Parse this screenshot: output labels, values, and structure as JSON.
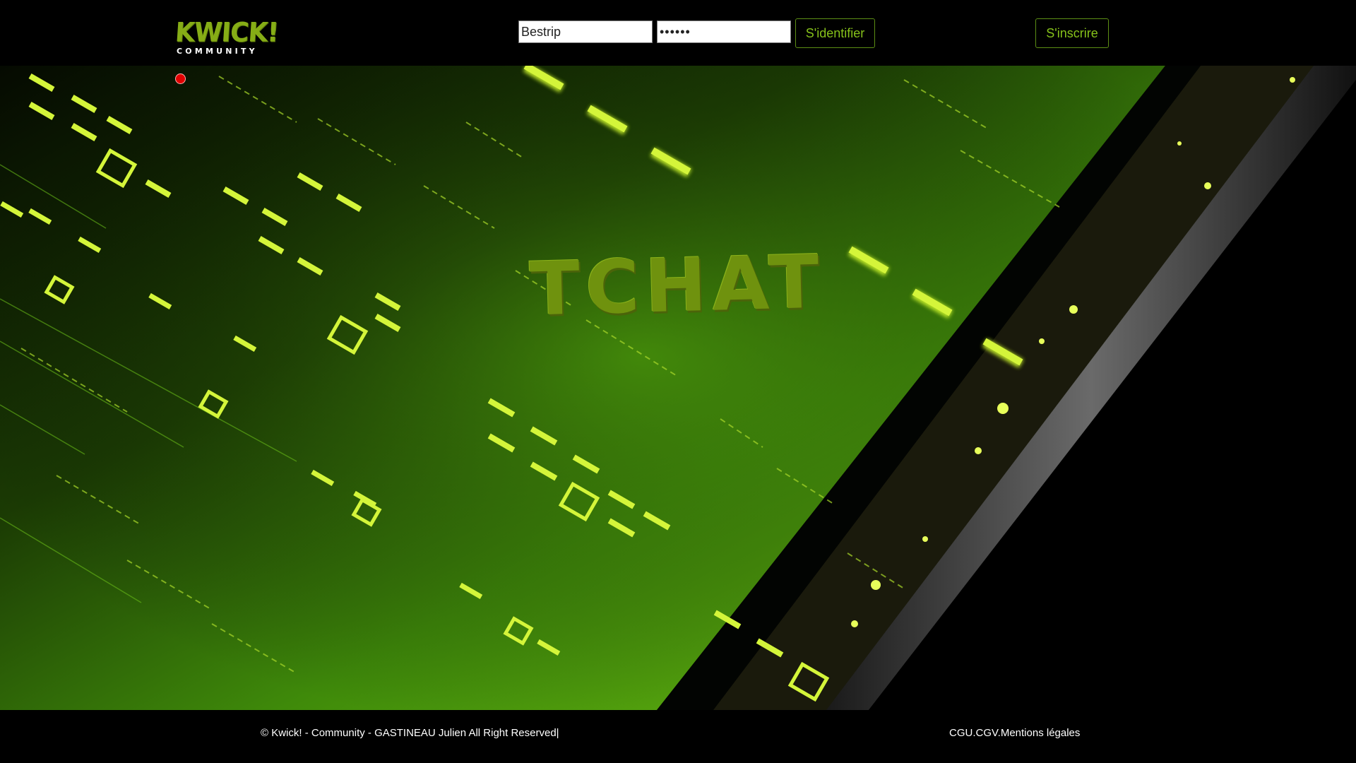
{
  "header": {
    "logo_text": "KWICK!",
    "logo_subtext": "COMMUNITY",
    "username_value": "Bestrip",
    "password_value": "••••••",
    "login_label": "S'identifier",
    "register_label": "S'inscrire"
  },
  "hero": {
    "title": "TCHAT"
  },
  "footer": {
    "copyright": "© Kwick! - Community - GASTINEAU Julien All Right Reserved|",
    "links": [
      "CGU",
      ".",
      "CGV",
      ".",
      "Mentions légales"
    ]
  },
  "colors": {
    "accent": "#86c21a",
    "title": "#6f920e",
    "status_dot": "#e10000",
    "neon": "#c8f02a"
  }
}
